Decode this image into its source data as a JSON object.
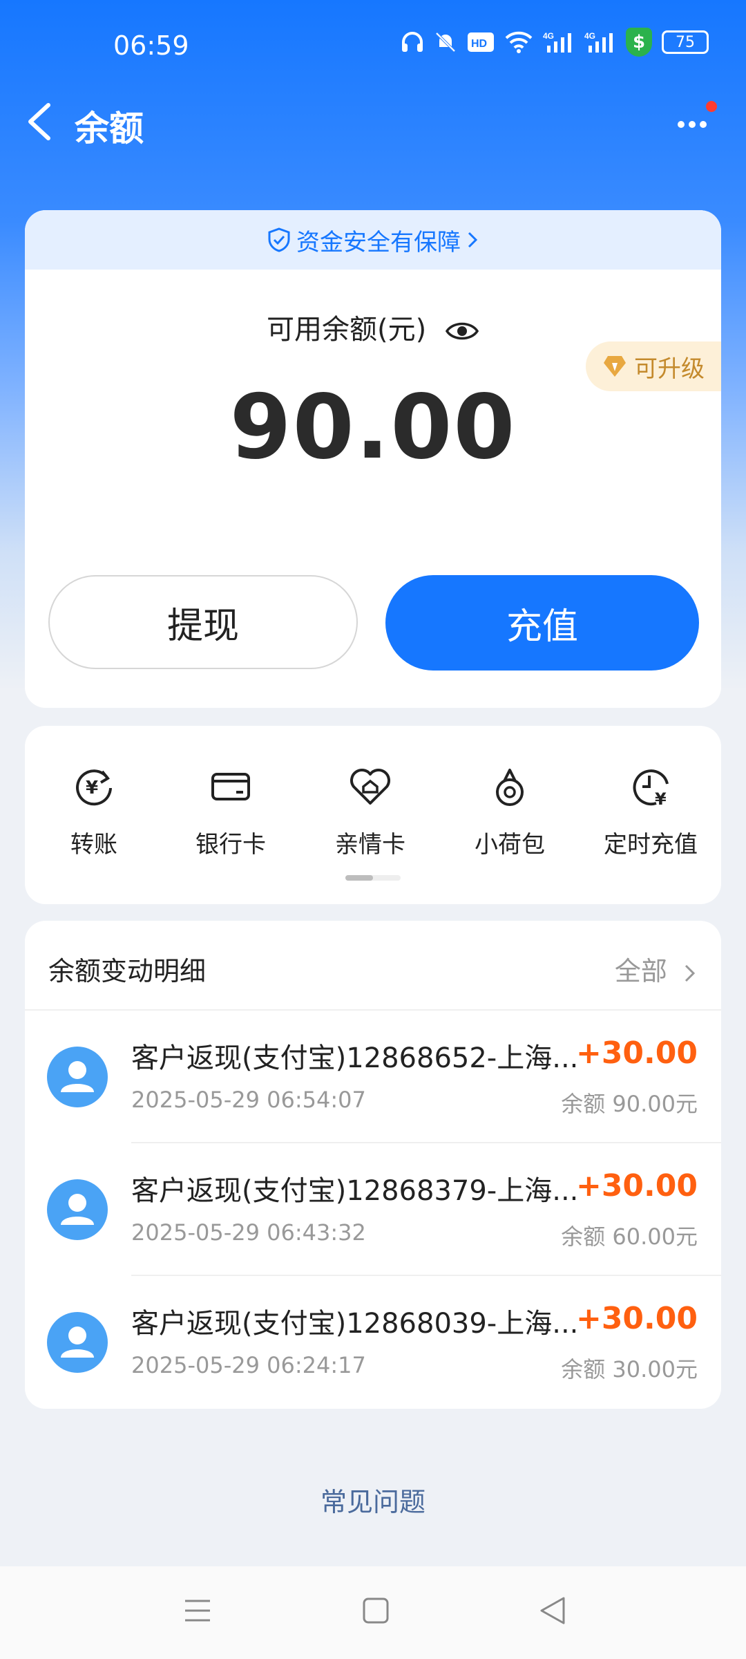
{
  "status_bar": {
    "time": "06:59",
    "battery": "75",
    "icons": [
      "headphones-icon",
      "mute-icon",
      "hd-icon",
      "wifi-icon",
      "4g-signal-icon",
      "4g-signal-icon",
      "security-shield-icon",
      "battery-icon"
    ]
  },
  "nav": {
    "title": "余额"
  },
  "card": {
    "safety_text": "资金安全有保障",
    "available_label": "可用余额(元)",
    "upgrade_label": "可升级",
    "balance": "90.00",
    "withdraw_label": "提现",
    "topup_label": "充值"
  },
  "shortcuts": [
    {
      "label": "转账",
      "icon": "transfer-icon"
    },
    {
      "label": "银行卡",
      "icon": "bank-card-icon"
    },
    {
      "label": "亲情卡",
      "icon": "family-card-icon"
    },
    {
      "label": "小荷包",
      "icon": "small-pouch-icon"
    },
    {
      "label": "定时充值",
      "icon": "scheduled-topup-icon"
    }
  ],
  "details": {
    "title": "余额变动明细",
    "filter": "全部",
    "rows": [
      {
        "title": "客户返现(支付宝)12868652-上海...",
        "amount": "+30.00",
        "time": "2025-05-29 06:54:07",
        "balance": "余额 90.00元"
      },
      {
        "title": "客户返现(支付宝)12868379-上海...",
        "amount": "+30.00",
        "time": "2025-05-29 06:43:32",
        "balance": "余额 60.00元"
      },
      {
        "title": "客户返现(支付宝)12868039-上海...",
        "amount": "+30.00",
        "time": "2025-05-29 06:24:17",
        "balance": "余额 30.00元"
      }
    ]
  },
  "faq": "常见问题",
  "colors": {
    "primary": "#1677ff",
    "amount_positive": "#ff6010",
    "upgrade": "#c48a2c"
  }
}
